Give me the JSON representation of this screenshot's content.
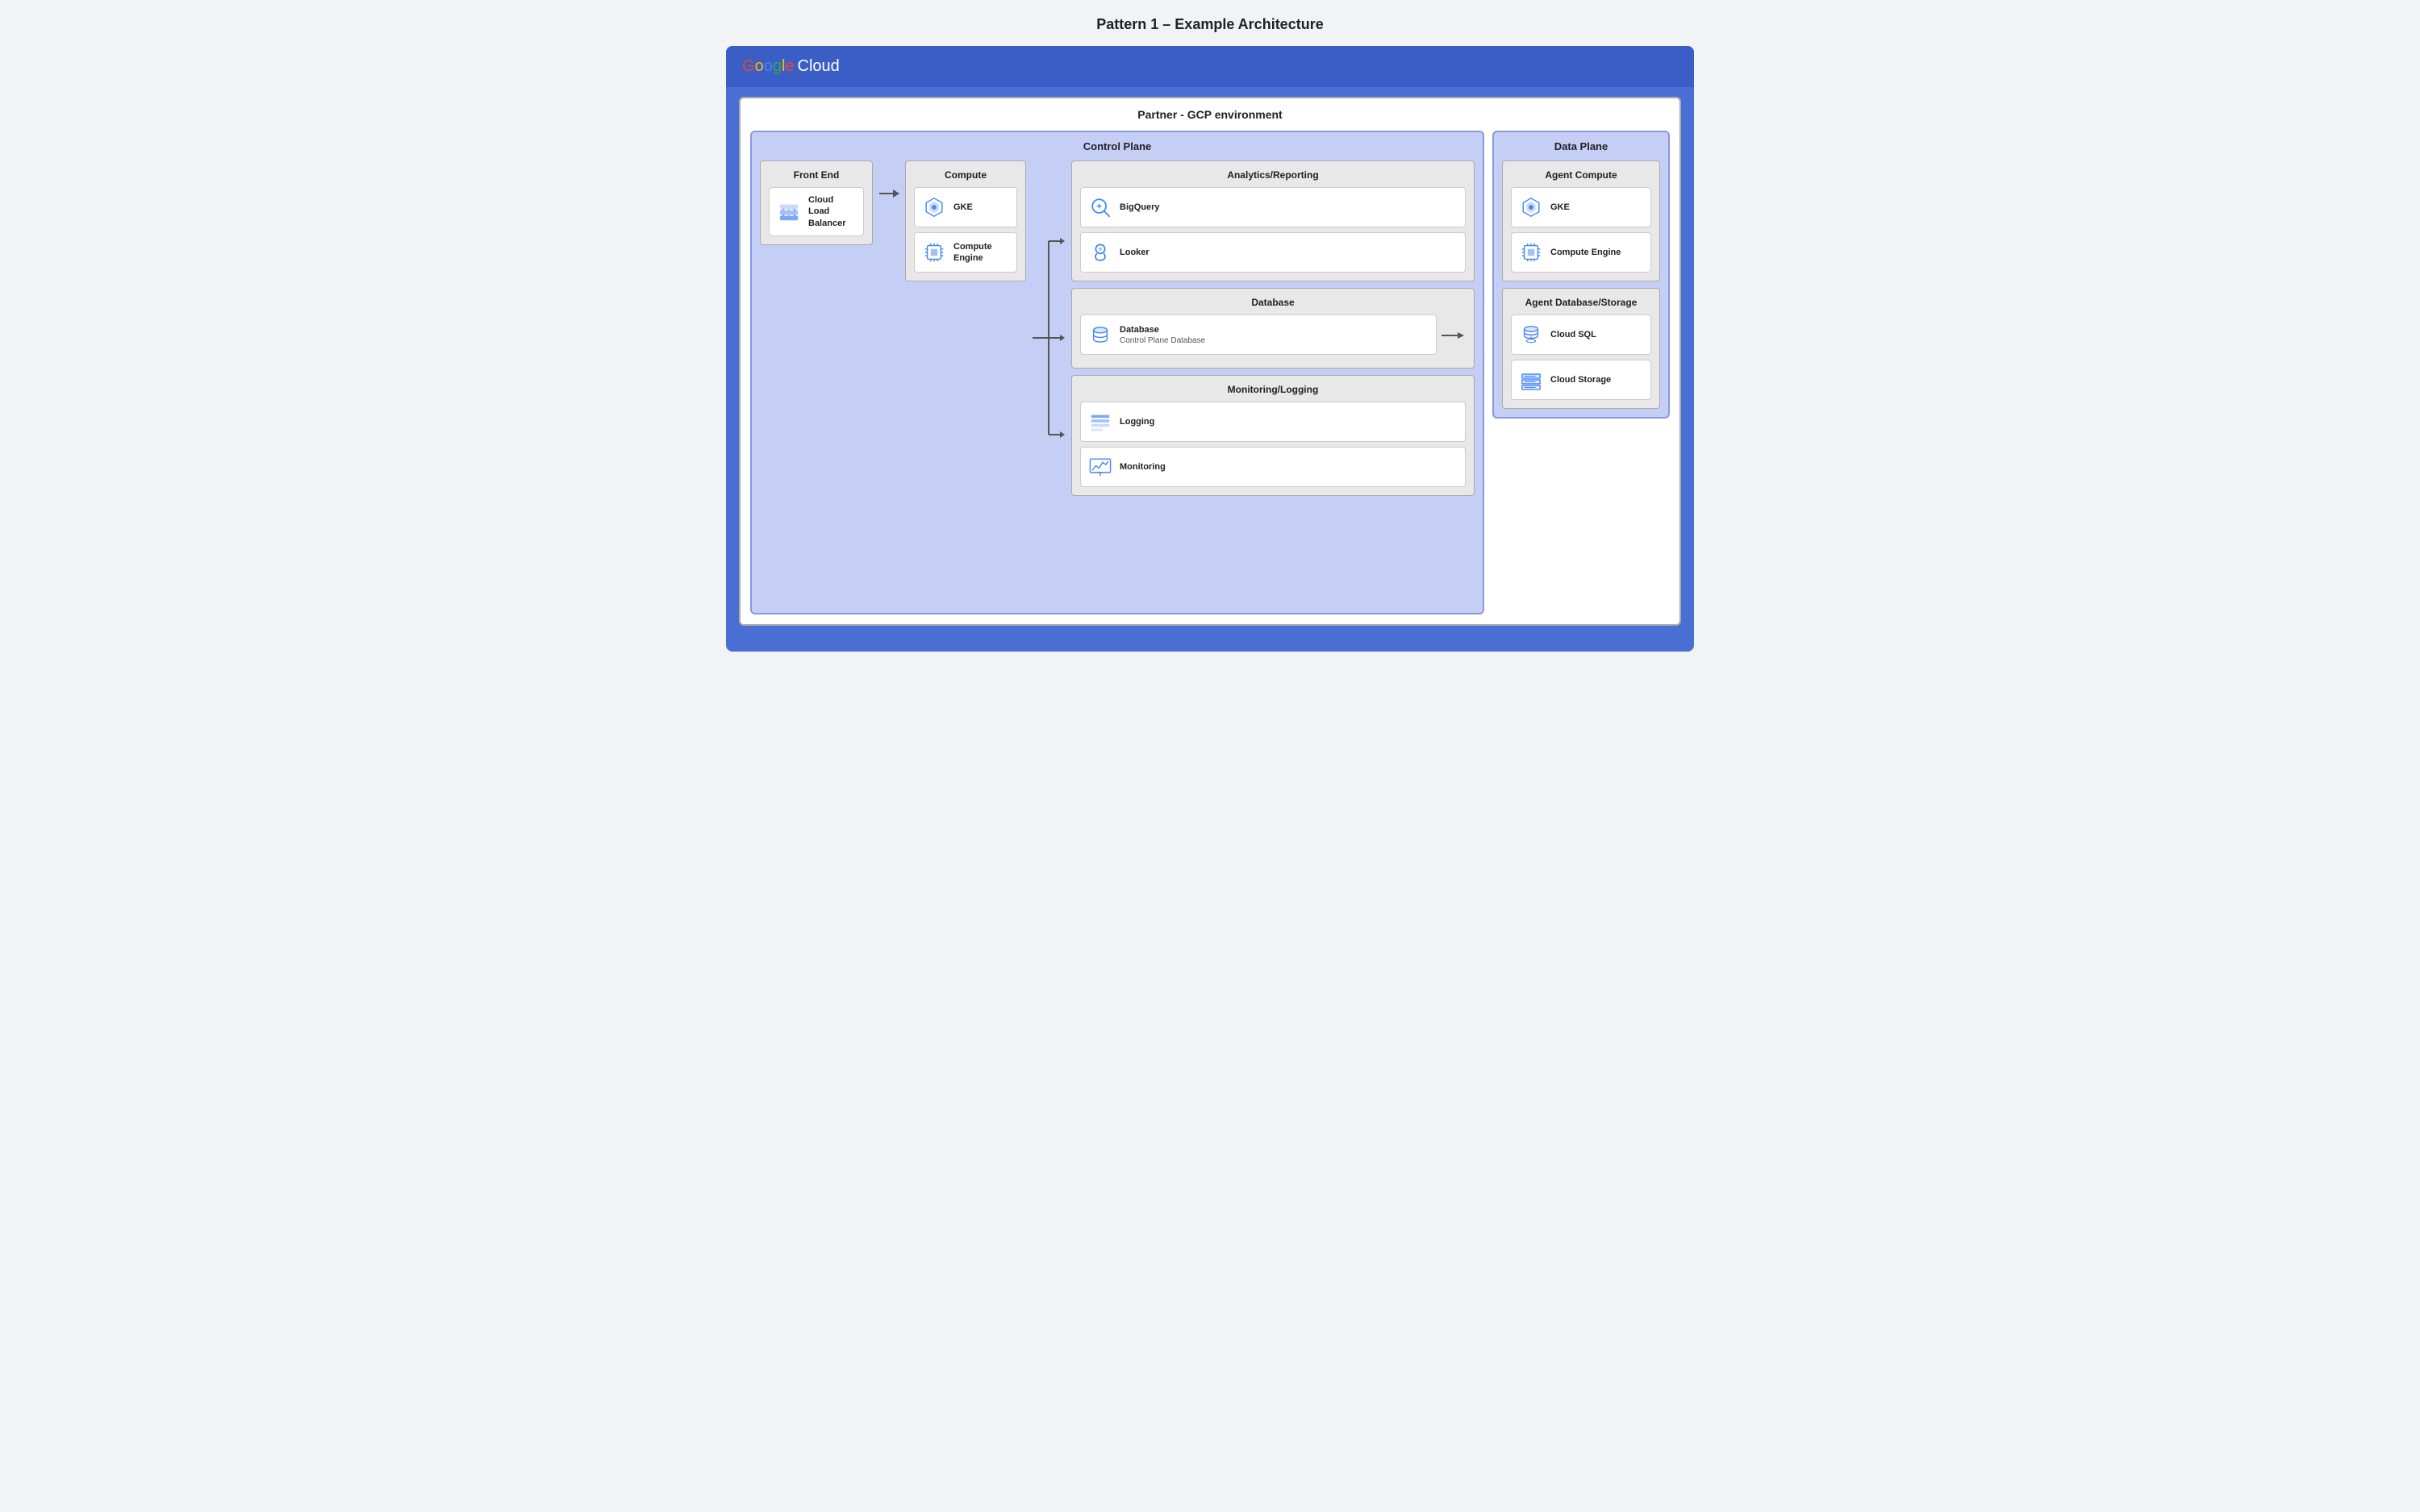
{
  "page": {
    "title": "Pattern 1 – Example Architecture"
  },
  "header": {
    "google": "Google",
    "cloud": "Cloud"
  },
  "partner_box": {
    "label": "Partner - GCP environment"
  },
  "control_plane": {
    "label": "Control Plane"
  },
  "data_plane": {
    "label": "Data Plane"
  },
  "frontend": {
    "title": "Front End",
    "services": [
      {
        "name": "Cloud Load Balancer",
        "sub": ""
      }
    ]
  },
  "compute": {
    "title": "Compute",
    "services": [
      {
        "name": "GKE",
        "sub": ""
      },
      {
        "name": "Compute Engine",
        "sub": ""
      }
    ]
  },
  "analytics": {
    "title": "Analytics/Reporting",
    "services": [
      {
        "name": "BigQuery",
        "sub": ""
      },
      {
        "name": "Looker",
        "sub": ""
      }
    ]
  },
  "database": {
    "title": "Database",
    "services": [
      {
        "name": "Database",
        "sub": "Control Plane Database"
      }
    ]
  },
  "monitoring": {
    "title": "Monitoring/Logging",
    "services": [
      {
        "name": "Logging",
        "sub": ""
      },
      {
        "name": "Monitoring",
        "sub": ""
      }
    ]
  },
  "agent_compute": {
    "title": "Agent Compute",
    "services": [
      {
        "name": "GKE",
        "sub": ""
      },
      {
        "name": "Compute Engine",
        "sub": ""
      }
    ]
  },
  "agent_db": {
    "title": "Agent Database/Storage",
    "services": [
      {
        "name": "Cloud SQL",
        "sub": ""
      },
      {
        "name": "Cloud Storage",
        "sub": ""
      }
    ]
  }
}
